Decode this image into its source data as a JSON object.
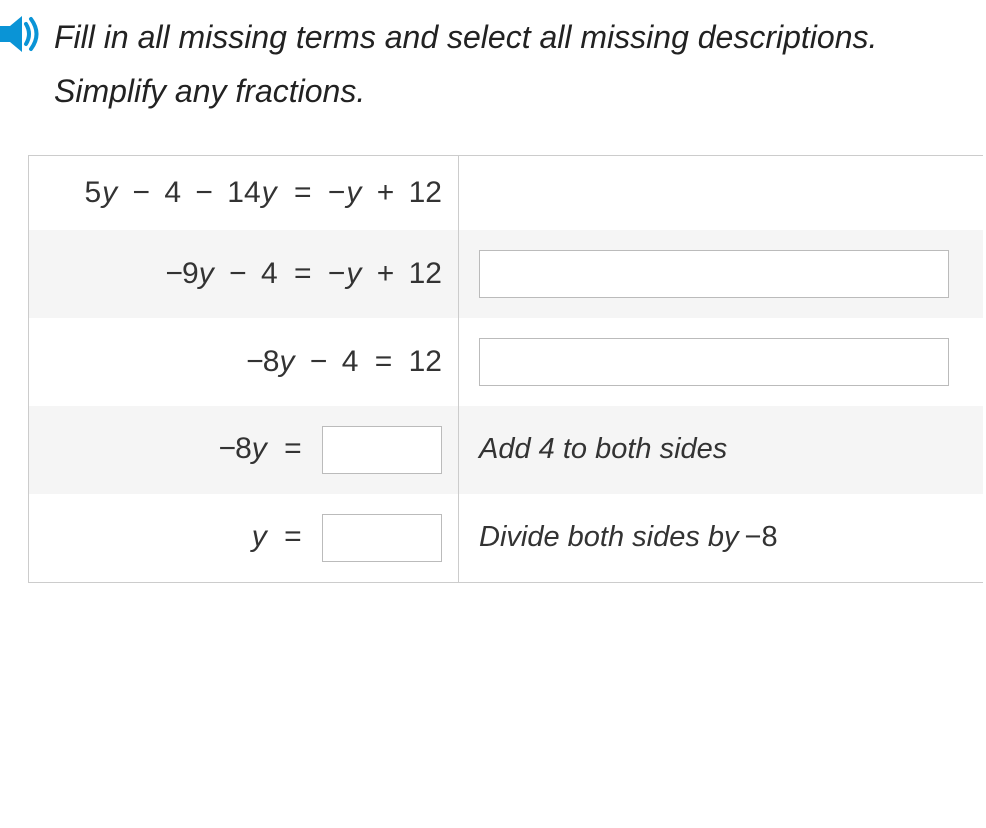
{
  "prompt": "Fill in all missing terms and select all missing descriptions. Simplify any fractions.",
  "rows": [
    {
      "equation_parts": {
        "t0": "5",
        "var0": "y",
        "op1": "−",
        "t1": "4",
        "op2": "−",
        "t2": "14",
        "var2": "y",
        "eq": "=",
        "t3": "−",
        "var3": "y",
        "op4": "+",
        "t4": "12"
      },
      "description": "",
      "has_input": false,
      "has_select": false
    },
    {
      "equation_parts": {
        "t0": "−9",
        "var0": "y",
        "op1": "−",
        "t1": "4",
        "eq": "=",
        "t3": "−",
        "var3": "y",
        "op4": "+",
        "t4": "12"
      },
      "description": "",
      "has_input": false,
      "has_select": true
    },
    {
      "equation_parts": {
        "t0": "−8",
        "var0": "y",
        "op1": "−",
        "t1": "4",
        "eq": "=",
        "t4": "12"
      },
      "description": "",
      "has_input": false,
      "has_select": true
    },
    {
      "equation_parts": {
        "t0": "−8",
        "var0": "y",
        "eq": "="
      },
      "description": "Add 4 to both sides",
      "has_input": true,
      "has_select": false
    },
    {
      "equation_parts": {
        "var0": "y",
        "eq": "="
      },
      "description_pre": "Divide both sides by ",
      "description_num": "−8",
      "has_input": true,
      "has_select": false
    }
  ]
}
